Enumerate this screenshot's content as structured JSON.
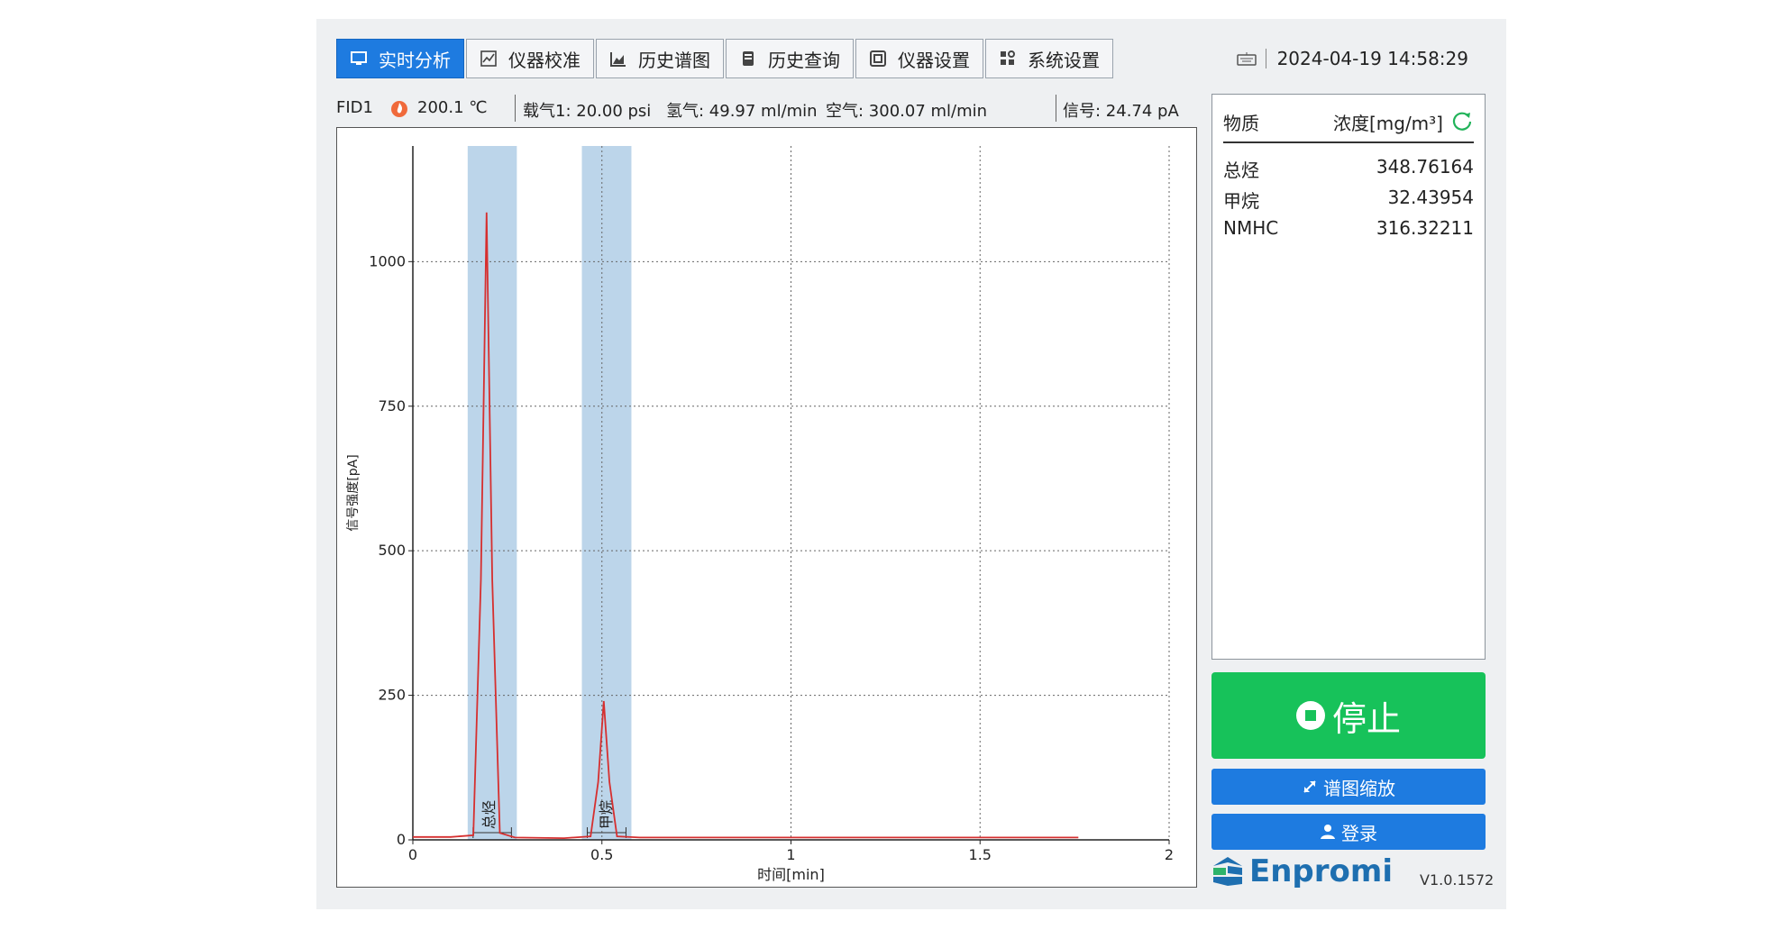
{
  "tabs": [
    {
      "label": "实时分析",
      "icon": "monitor-icon",
      "active": true
    },
    {
      "label": "仪器校准",
      "icon": "calibration-icon",
      "active": false
    },
    {
      "label": "历史谱图",
      "icon": "chart-icon",
      "active": false
    },
    {
      "label": "历史查询",
      "icon": "database-icon",
      "active": false
    },
    {
      "label": "仪器设置",
      "icon": "instrument-icon",
      "active": false
    },
    {
      "label": "系统设置",
      "icon": "grid-settings-icon",
      "active": false
    }
  ],
  "datetime": "2024-04-19 14:58:29",
  "status": {
    "detector": "FID1",
    "temperature": "200.1 ℃",
    "carrier_gas": "载气1: 20.00 psi",
    "hydrogen": "氢气: 49.97 ml/min",
    "air": "空气: 300.07 ml/min",
    "signal": "信号: 24.74 pA"
  },
  "results": {
    "header_substance": "物质",
    "header_concentration": "浓度[mg/m³]",
    "rows": [
      {
        "name": "总烃",
        "value": "348.76164"
      },
      {
        "name": "甲烷",
        "value": "32.43954"
      },
      {
        "name": "NMHC",
        "value": "316.32211"
      }
    ]
  },
  "buttons": {
    "stop": "停止",
    "zoom": "谱图缩放",
    "login": "登录"
  },
  "brand": "Enpromi",
  "version": "V1.0.1572",
  "colors": {
    "accent": "#1e7be0",
    "stop": "#17c25a",
    "trace": "#d62f2f",
    "window_band": "#bcd5ea"
  },
  "chart_data": {
    "type": "line",
    "xlabel": "时间[min]",
    "ylabel": "信号强度[pA]",
    "xlim": [
      0,
      2
    ],
    "ylim": [
      0,
      1200
    ],
    "x_ticks": [
      0,
      0.5,
      1,
      1.5,
      2
    ],
    "x_tick_labels": [
      "0",
      "0.5",
      "1",
      "1.5",
      "2"
    ],
    "y_ticks": [
      0,
      250,
      500,
      750,
      1000
    ],
    "y_tick_labels": [
      "0",
      "250",
      "500",
      "750",
      "1000"
    ],
    "grid": true,
    "series": [
      {
        "x": [
          0,
          0.1,
          0.16,
          0.18,
          0.195,
          0.21,
          0.23,
          0.27,
          0.4,
          0.47,
          0.49,
          0.505,
          0.52,
          0.54,
          0.6,
          1.0,
          1.5,
          1.76
        ],
        "y": [
          5,
          5,
          8,
          450,
          1085,
          450,
          12,
          4,
          3,
          6,
          100,
          240,
          100,
          6,
          4,
          4,
          4,
          4
        ]
      }
    ],
    "bands": [
      {
        "label": "总烃",
        "x0": 0.145,
        "x1": 0.275,
        "peak_x": 0.195
      },
      {
        "label": "甲烷",
        "x0": 0.447,
        "x1": 0.578,
        "peak_x": 0.505
      }
    ]
  }
}
